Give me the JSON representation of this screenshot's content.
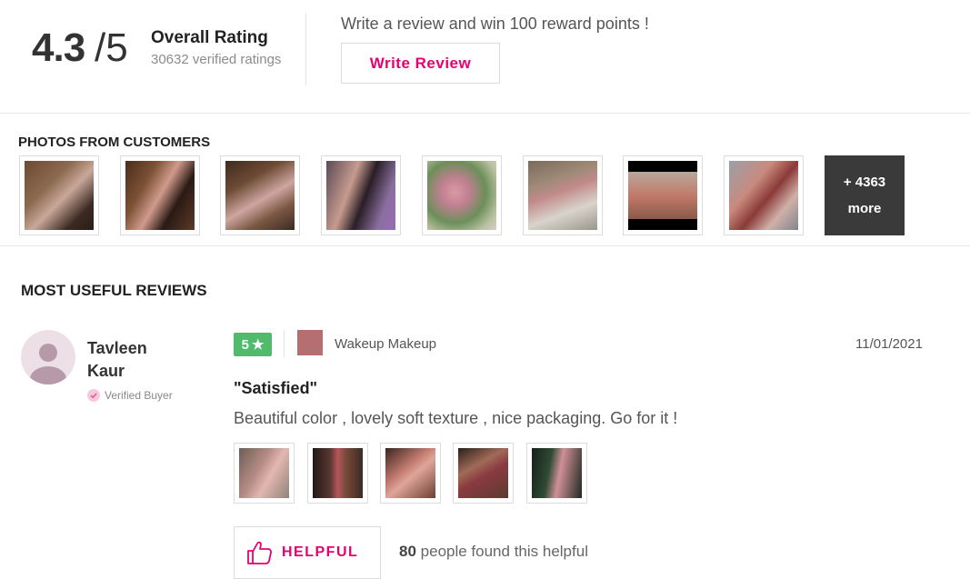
{
  "rating": {
    "score": "4.3",
    "max": "/5",
    "title": "Overall Rating",
    "subtitle": "30632 verified ratings"
  },
  "promo": {
    "text": "Write a review and win 100 reward points !",
    "button_label": "Write Review"
  },
  "photos": {
    "title": "PHOTOS FROM CUSTOMERS",
    "more_count": "+ 4363",
    "more_label": "more"
  },
  "reviews": {
    "title": "MOST USEFUL REVIEWS",
    "items": [
      {
        "reviewer_first": "Tavleen",
        "reviewer_last": "Kaur",
        "verified_label": "Verified Buyer",
        "rating": "5",
        "shade_color": "#b56f71",
        "shade_name": "Wakeup Makeup",
        "date": "11/01/2021",
        "title": "\"Satisfied\"",
        "body": "Beautiful color , lovely soft texture , nice packaging. Go for it !",
        "helpful_label": "HELPFUL",
        "helpful_count": "80",
        "helpful_text": "people found this helpful"
      }
    ]
  },
  "colors": {
    "brand_pink": "#e80071",
    "rating_green": "#4fbb6b"
  }
}
